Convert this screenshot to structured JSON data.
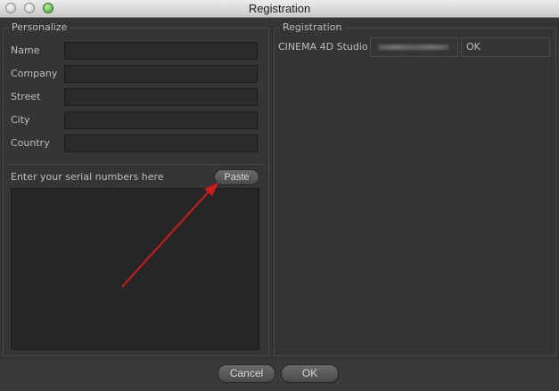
{
  "window": {
    "title": "Registration"
  },
  "personalize": {
    "title": "Personalize",
    "fields": [
      {
        "label": "Name",
        "value": ""
      },
      {
        "label": "Company",
        "value": ""
      },
      {
        "label": "Street",
        "value": ""
      },
      {
        "label": "City",
        "value": ""
      },
      {
        "label": "Country",
        "value": ""
      }
    ],
    "serial_label": "Enter your serial numbers here",
    "paste_label": "Paste",
    "serial_value": ""
  },
  "registration": {
    "title": "Registration",
    "rows": [
      {
        "product": "CINEMA 4D Studio",
        "status": "OK"
      }
    ]
  },
  "footer": {
    "cancel_label": "Cancel",
    "ok_label": "OK"
  },
  "annotation": {
    "arrow_color": "#d11a1a",
    "points_to": "paste-button"
  }
}
